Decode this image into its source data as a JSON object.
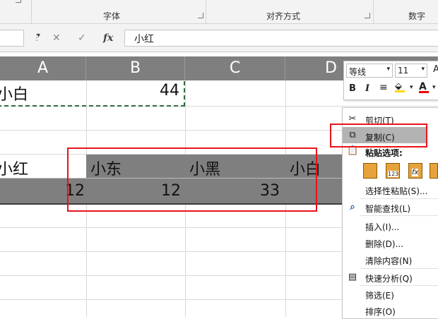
{
  "ribbon": {
    "groups": [
      "字体",
      "对齐方式",
      "数字"
    ]
  },
  "formula_bar": {
    "cancel_icon": "✕",
    "enter_icon": "✓",
    "fx_label": "fx",
    "value": "小红"
  },
  "columns": [
    "A",
    "B",
    "C",
    "D"
  ],
  "cells": {
    "row1": {
      "a": "小白",
      "b": "44"
    },
    "row3": {
      "a": "小红",
      "b": "小东",
      "c": "小黑",
      "d": "小白"
    },
    "row4": {
      "a": "12",
      "b": "12",
      "c": "33"
    }
  },
  "mini_toolbar": {
    "font_name": "等线",
    "font_size": "11",
    "bold": "B",
    "italic": "I",
    "font_color_letter": "A"
  },
  "context_menu": {
    "items": [
      "剪切(T)",
      "复制(C)",
      "粘贴选项:",
      "选择性粘贴(S)...",
      "智能查找(L)",
      "插入(I)...",
      "删除(D)...",
      "清除内容(N)",
      "快速分析(Q)",
      "筛选(E)",
      "排序(O)"
    ],
    "paste_option_badges": [
      "123",
      "fx"
    ]
  },
  "colors": {
    "annotation_red": "#e8141a",
    "header_gray": "#7f7f7f",
    "menu_highlight": "#b3b3b3"
  }
}
